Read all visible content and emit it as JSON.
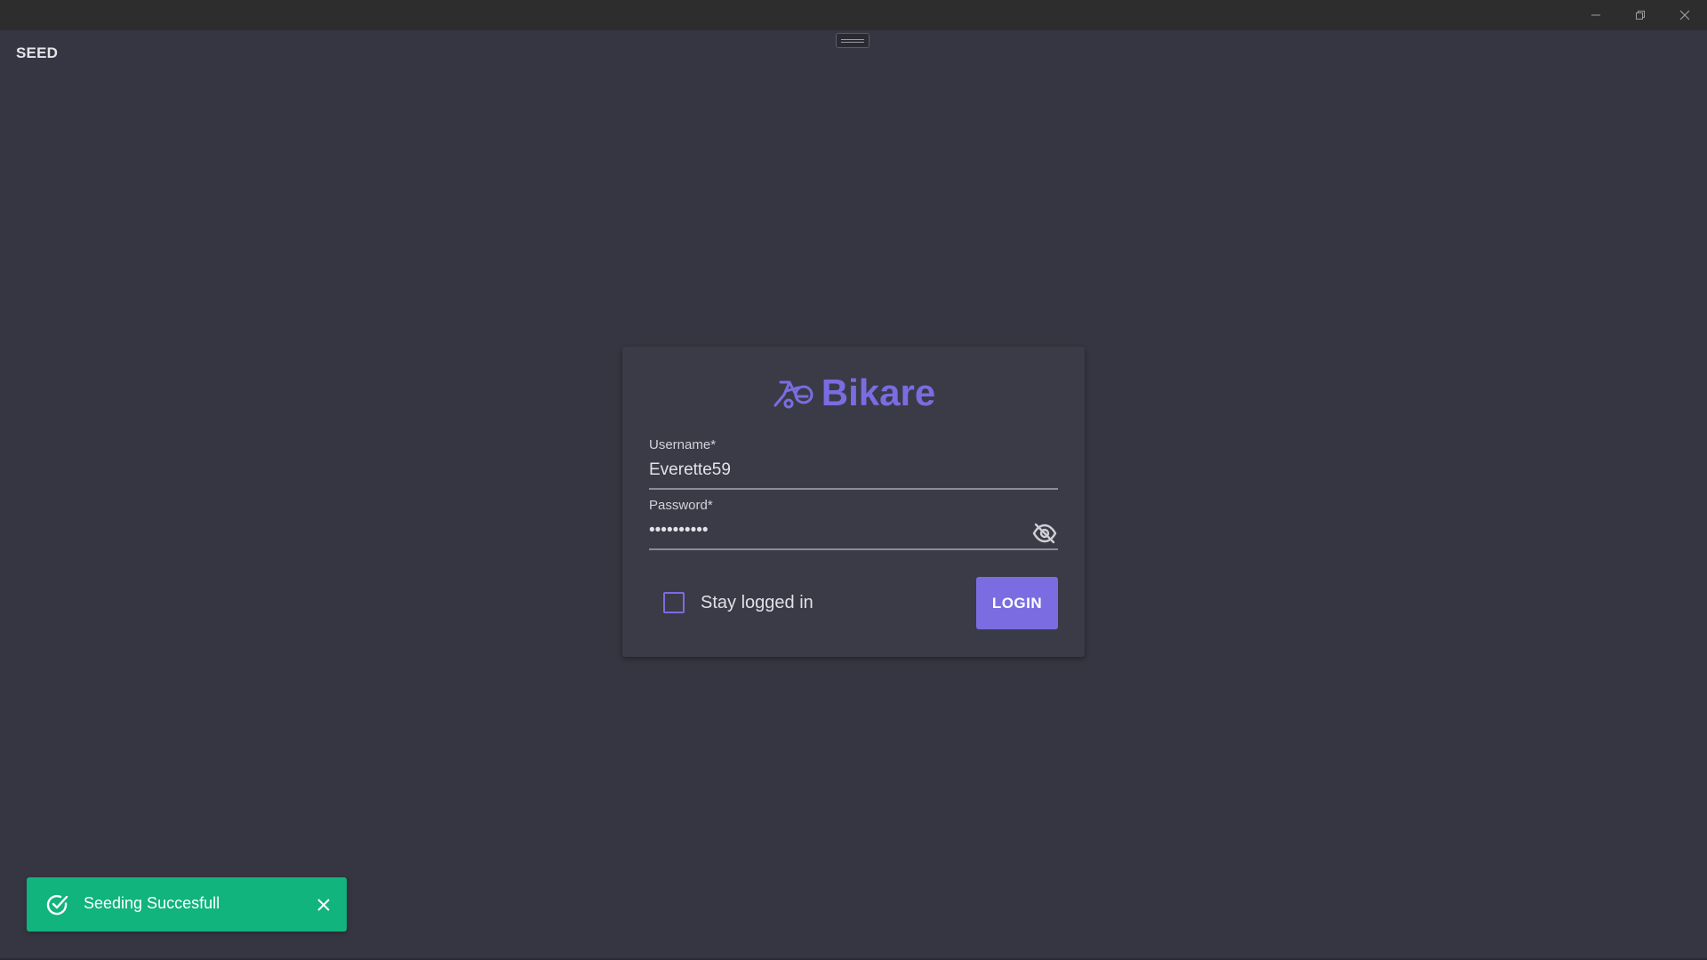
{
  "window": {
    "controls": [
      "minimize-icon",
      "maximize-icon",
      "close-icon"
    ]
  },
  "header": {
    "seed_label": "SEED"
  },
  "login": {
    "brand_name": "Bikare",
    "brand_icon": "bike-logo-icon",
    "username_label": "Username*",
    "username_value": "Everette59",
    "password_label": "Password*",
    "password_value": "••••••••••",
    "password_toggle_icon": "eye-off-icon",
    "stay_logged_in_label": "Stay logged in",
    "stay_logged_in_checked": false,
    "login_button_label": "LOGIN"
  },
  "toast": {
    "message": "Seeding Succesfull",
    "icon": "check-circle-icon",
    "close_icon": "close-icon"
  },
  "colors": {
    "background": "#353641",
    "card": "#3a3b46",
    "accent": "#7b6ce2",
    "toast": "#10b47c",
    "titlebar": "#2d2d2d"
  }
}
